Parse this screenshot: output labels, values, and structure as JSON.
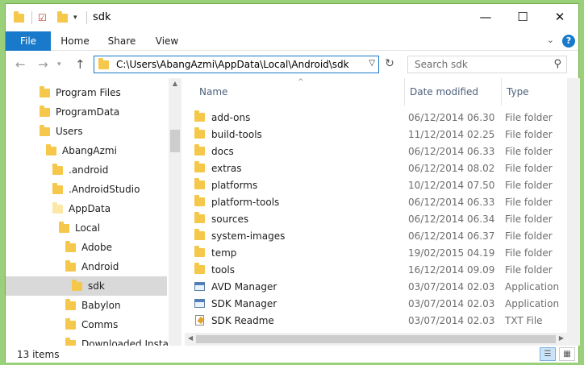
{
  "window": {
    "title": "sdk",
    "controls": {
      "minimize": "—",
      "maximize": "☐",
      "close": "✕"
    }
  },
  "ribbon": {
    "tabs": [
      "File",
      "Home",
      "Share",
      "View"
    ],
    "help": "?"
  },
  "address_bar": {
    "path": "C:\\Users\\AbangAzmi\\AppData\\Local\\Android\\sdk",
    "search_placeholder": "Search sdk"
  },
  "nav_tree": [
    {
      "label": "Program Files",
      "indent": 0
    },
    {
      "label": "ProgramData",
      "indent": 0
    },
    {
      "label": "Users",
      "indent": 0
    },
    {
      "label": "AbangAzmi",
      "indent": 1
    },
    {
      "label": ".android",
      "indent": 2
    },
    {
      "label": ".AndroidStudio",
      "indent": 2
    },
    {
      "label": "AppData",
      "indent": 2,
      "pale": true
    },
    {
      "label": "Local",
      "indent": 3
    },
    {
      "label": "Adobe",
      "indent": 4
    },
    {
      "label": "Android",
      "indent": 4
    },
    {
      "label": "sdk",
      "indent": 5,
      "selected": true
    },
    {
      "label": "Babylon",
      "indent": 4
    },
    {
      "label": "Comms",
      "indent": 4
    },
    {
      "label": "Downloaded Installati",
      "indent": 4
    }
  ],
  "columns": {
    "name": "Name",
    "date": "Date modified",
    "type": "Type"
  },
  "files": [
    {
      "name": "add-ons",
      "date": "06/12/2014 06.30",
      "type": "File folder",
      "icon": "folder-icon"
    },
    {
      "name": "build-tools",
      "date": "11/12/2014 02.25",
      "type": "File folder",
      "icon": "folder-icon"
    },
    {
      "name": "docs",
      "date": "06/12/2014 06.33",
      "type": "File folder",
      "icon": "folder-icon"
    },
    {
      "name": "extras",
      "date": "06/12/2014 08.02",
      "type": "File folder",
      "icon": "folder-icon"
    },
    {
      "name": "platforms",
      "date": "10/12/2014 07.50",
      "type": "File folder",
      "icon": "folder-icon"
    },
    {
      "name": "platform-tools",
      "date": "06/12/2014 06.33",
      "type": "File folder",
      "icon": "folder-icon"
    },
    {
      "name": "sources",
      "date": "06/12/2014 06.34",
      "type": "File folder",
      "icon": "folder-icon"
    },
    {
      "name": "system-images",
      "date": "06/12/2014 06.37",
      "type": "File folder",
      "icon": "folder-icon"
    },
    {
      "name": "temp",
      "date": "19/02/2015 04.19",
      "type": "File folder",
      "icon": "folder-icon"
    },
    {
      "name": "tools",
      "date": "16/12/2014 09.09",
      "type": "File folder",
      "icon": "folder-icon"
    },
    {
      "name": "AVD Manager",
      "date": "03/07/2014 02.03",
      "type": "Application",
      "icon": "application-icon"
    },
    {
      "name": "SDK Manager",
      "date": "03/07/2014 02.03",
      "type": "Application",
      "icon": "application-icon"
    },
    {
      "name": "SDK Readme",
      "date": "03/07/2014 02.03",
      "type": "TXT File",
      "icon": "text-file-icon"
    }
  ],
  "status": {
    "item_count": "13 items"
  },
  "colors": {
    "accent": "#1979ca",
    "selected_bg": "#d9d9d9",
    "folder": "#f5c84c"
  }
}
